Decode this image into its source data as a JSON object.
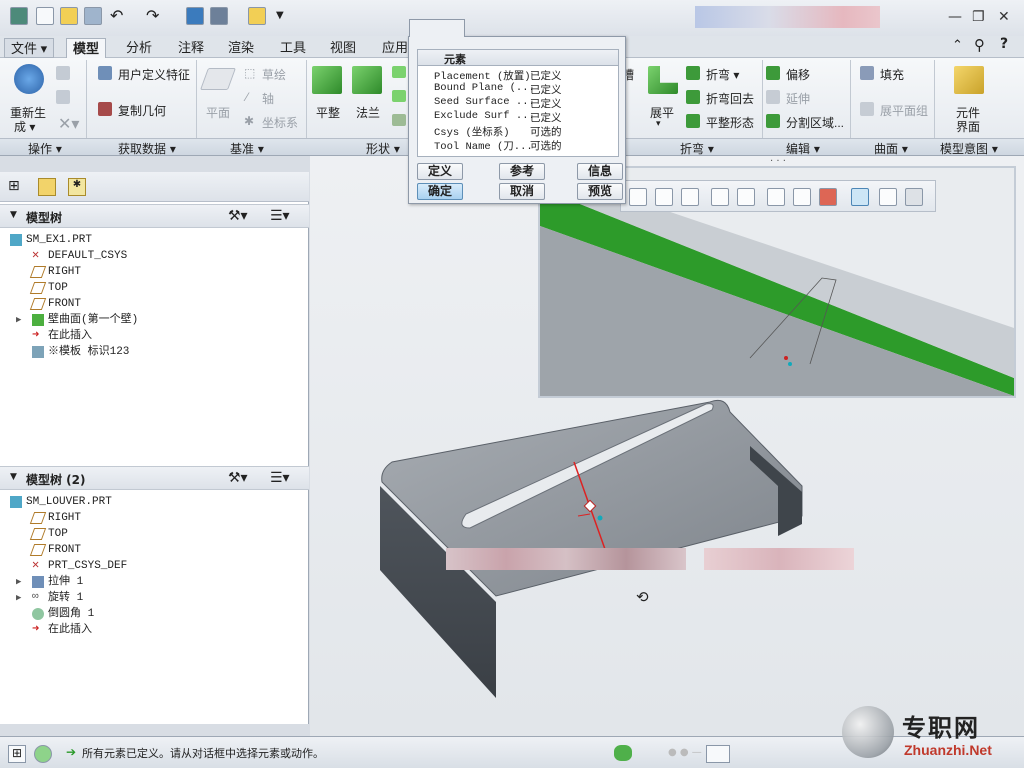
{
  "ribbon_tabs": [
    {
      "label": "文件 ▾"
    },
    {
      "label": "模型"
    },
    {
      "label": "分析"
    },
    {
      "label": "注释"
    },
    {
      "label": "渲染"
    },
    {
      "label": "工具"
    },
    {
      "label": "视图"
    },
    {
      "label": "应用"
    }
  ],
  "ribbon": {
    "regen_line1": "重新生",
    "regen_line2": "成 ▾",
    "user_feature": "用户定义特征",
    "copy_geom": "复制几何",
    "plane": "平面",
    "sketch": "草绘",
    "axis": "轴",
    "csys": "坐标系",
    "flatten": "平整",
    "flange": "法兰",
    "unbend": "展平",
    "bend": "折弯 ▾",
    "bend_back": "折弯回去",
    "flat_form": "平整形态",
    "offset": "偏移",
    "extend": "延伸",
    "split_area": "分割区域...",
    "fill": "填充",
    "flat_pattern": "展平面组",
    "component_line1": "元件",
    "component_line2": "界面"
  },
  "groups": [
    "操作 ▾",
    "获取数据 ▾",
    "基准 ▾",
    "形状 ▾",
    "折弯 ▾",
    "编辑 ▾",
    "曲面 ▾",
    "模型意图 ▾"
  ],
  "tree1": {
    "title": "模型树",
    "items": [
      {
        "text": "SM_EX1.PRT"
      },
      {
        "text": "DEFAULT_CSYS"
      },
      {
        "text": "RIGHT"
      },
      {
        "text": "TOP"
      },
      {
        "text": "FRONT"
      },
      {
        "text": "壁曲面(第一个壁)"
      },
      {
        "text": "在此插入"
      },
      {
        "text": "※模板 标识123"
      }
    ]
  },
  "tree2": {
    "title": "模型树 (2)",
    "items": [
      {
        "text": "SM_LOUVER.PRT"
      },
      {
        "text": "RIGHT"
      },
      {
        "text": "TOP"
      },
      {
        "text": "FRONT"
      },
      {
        "text": "PRT_CSYS_DEF"
      },
      {
        "text": "拉伸 1"
      },
      {
        "text": "旋转 1"
      },
      {
        "text": "倒圆角 1"
      },
      {
        "text": "在此插入"
      }
    ]
  },
  "dialog": {
    "header": "元素",
    "rows": [
      {
        "name": "Placement (放置)",
        "status": "已定义"
      },
      {
        "name": "Bound Plane (...",
        "status": "已定义"
      },
      {
        "name": "Seed Surface ...",
        "status": "已定义"
      },
      {
        "name": "Exclude Surf ...",
        "status": "已定义"
      },
      {
        "name": "Csys (坐标系)",
        "status": "可选的"
      },
      {
        "name": "Tool Name (刀...",
        "status": "可选的"
      }
    ],
    "btn_define": "定义",
    "btn_refs": "参考",
    "btn_info": "信息",
    "btn_ok": "确定",
    "btn_cancel": "取消",
    "btn_preview": "预览"
  },
  "status": {
    "message": "所有元素已定义。请从对话框中选择元素或动作。"
  },
  "watermark": {
    "brand": "专职网",
    "url": "Zhuanzhi.Net"
  }
}
